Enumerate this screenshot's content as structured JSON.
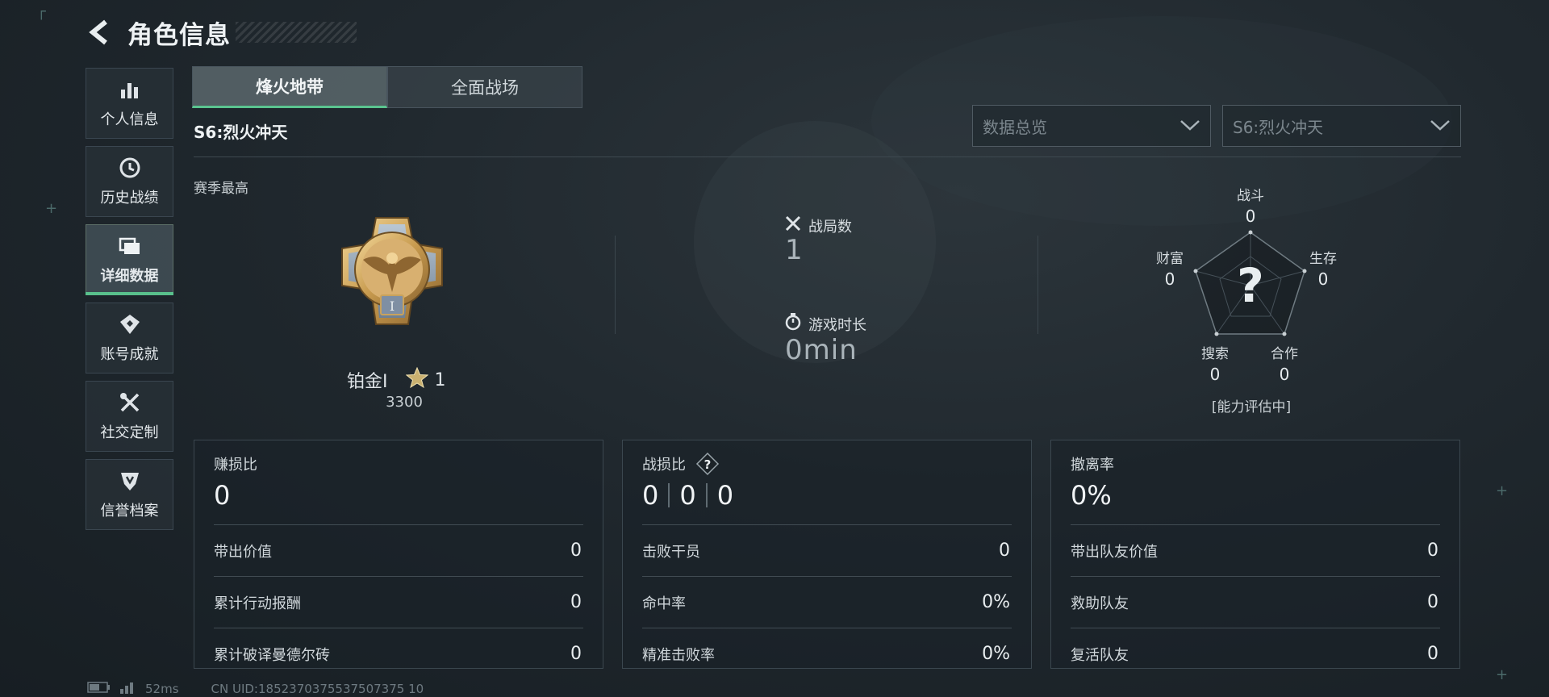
{
  "header": {
    "title": "角色信息"
  },
  "sidebar": {
    "items": [
      {
        "label": "个人信息"
      },
      {
        "label": "历史战绩"
      },
      {
        "label": "详细数据"
      },
      {
        "label": "账号成就"
      },
      {
        "label": "社交定制"
      },
      {
        "label": "信誉档案"
      }
    ],
    "active_index": 2
  },
  "tabs": [
    {
      "label": "烽火地带"
    },
    {
      "label": "全面战场"
    }
  ],
  "season": {
    "title": "S6:烈火冲天"
  },
  "filters": {
    "overview": "数据总览",
    "season": "S6:烈火冲天"
  },
  "rank": {
    "section_label": "赛季最高",
    "name": "铂金I",
    "stars": "1",
    "points": "3300",
    "medal_numeral": "I"
  },
  "summary": {
    "matches_label": "战局数",
    "matches_value": "1",
    "playtime_label": "游戏时长",
    "playtime_value": "0min"
  },
  "radar": {
    "center_mark": "?",
    "axes": [
      {
        "label": "战斗",
        "value": "0"
      },
      {
        "label": "生存",
        "value": "0"
      },
      {
        "label": "合作",
        "value": "0"
      },
      {
        "label": "搜索",
        "value": "0"
      },
      {
        "label": "财富",
        "value": "0"
      }
    ],
    "note": "[能力评估中]"
  },
  "panels": [
    {
      "title": "赚损比",
      "big": "0",
      "rows": [
        {
          "label": "带出价值",
          "value": "0"
        },
        {
          "label": "累计行动报酬",
          "value": "0"
        },
        {
          "label": "累计破译曼德尔砖",
          "value": "0"
        }
      ]
    },
    {
      "title": "战损比",
      "big_parts": [
        "0",
        "0",
        "0"
      ],
      "help_mark": "?",
      "rows": [
        {
          "label": "击败干员",
          "value": "0"
        },
        {
          "label": "命中率",
          "value": "0%"
        },
        {
          "label": "精准击败率",
          "value": "0%"
        }
      ]
    },
    {
      "title": "撤离率",
      "big": "0%",
      "rows": [
        {
          "label": "带出队友价值",
          "value": "0"
        },
        {
          "label": "救助队友",
          "value": "0"
        },
        {
          "label": "复活队友",
          "value": "0"
        }
      ]
    }
  ],
  "footer": {
    "ping": "52ms",
    "uid": "CN UID:1852370375537507375 10"
  },
  "colors": {
    "accent": "#59c08c",
    "background": "#1f272d"
  }
}
